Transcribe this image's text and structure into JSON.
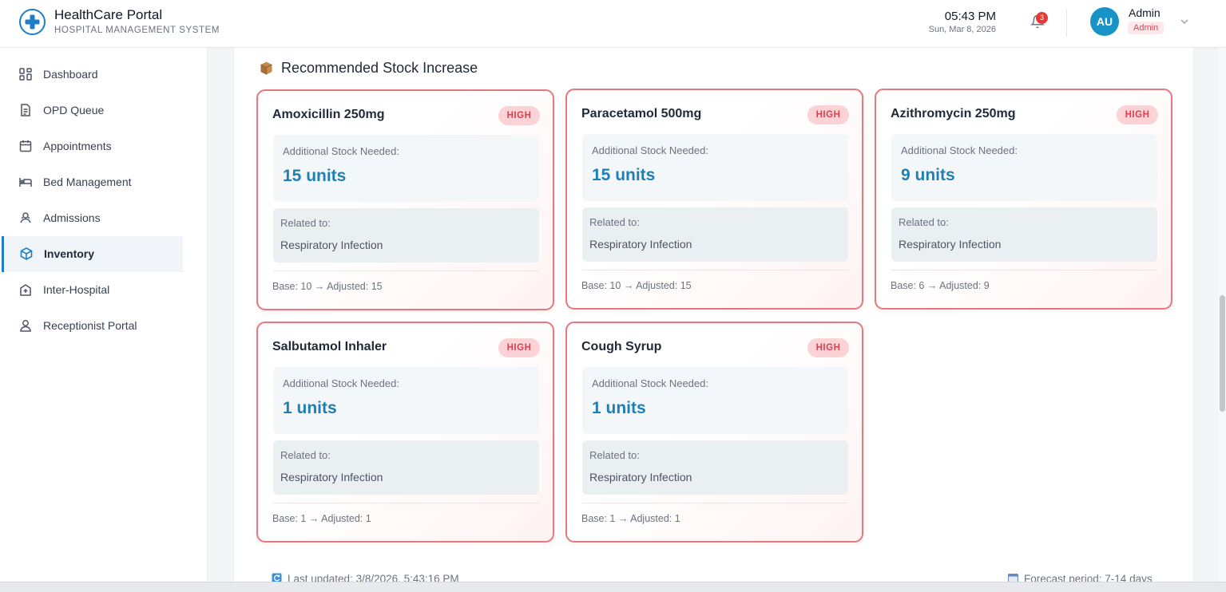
{
  "app": {
    "title": "HealthCare Portal",
    "subtitle": "HOSPITAL MANAGEMENT SYSTEM"
  },
  "header": {
    "time": "05:43 PM",
    "date": "Sun, Mar 8, 2026",
    "notification_count": "3",
    "user_initials": "AU",
    "user_name": "Admin",
    "user_role": "Admin"
  },
  "sidebar": {
    "items": [
      {
        "label": "Dashboard",
        "icon": "grid-icon"
      },
      {
        "label": "OPD Queue",
        "icon": "clipboard-icon"
      },
      {
        "label": "Appointments",
        "icon": "calendar-icon"
      },
      {
        "label": "Bed Management",
        "icon": "bed-icon"
      },
      {
        "label": "Admissions",
        "icon": "person-icon"
      },
      {
        "label": "Inventory",
        "icon": "box-icon",
        "active": true
      },
      {
        "label": "Inter-Hospital",
        "icon": "hospital-icon"
      },
      {
        "label": "Receptionist Portal",
        "icon": "user-icon"
      }
    ]
  },
  "section": {
    "title": "Recommended Stock Increase",
    "icon": "package-icon"
  },
  "cards": [
    {
      "name": "Amoxicillin 250mg",
      "priority": "HIGH",
      "stock_label": "Additional Stock Needed:",
      "stock": "15 units",
      "related_label": "Related to:",
      "related": "Respiratory Infection",
      "base": "Base: 10 → Adjusted: 15"
    },
    {
      "name": "Paracetamol 500mg",
      "priority": "HIGH",
      "stock_label": "Additional Stock Needed:",
      "stock": "15 units",
      "related_label": "Related to:",
      "related": "Respiratory Infection",
      "base": "Base: 10 → Adjusted: 15"
    },
    {
      "name": "Azithromycin 250mg",
      "priority": "HIGH",
      "stock_label": "Additional Stock Needed:",
      "stock": "9 units",
      "related_label": "Related to:",
      "related": "Respiratory Infection",
      "base": "Base: 6 → Adjusted: 9"
    },
    {
      "name": "Salbutamol Inhaler",
      "priority": "HIGH",
      "stock_label": "Additional Stock Needed:",
      "stock": "1 units",
      "related_label": "Related to:",
      "related": "Respiratory Infection",
      "base": "Base: 1 → Adjusted: 1"
    },
    {
      "name": "Cough Syrup",
      "priority": "HIGH",
      "stock_label": "Additional Stock Needed:",
      "stock": "1 units",
      "related_label": "Related to:",
      "related": "Respiratory Infection",
      "base": "Base: 1 → Adjusted: 1"
    }
  ],
  "footer": {
    "last_updated": "Last updated: 3/8/2026, 5:43:16 PM",
    "forecast_period": "Forecast period: 7-14 days"
  },
  "colors": {
    "accent": "#1e7ec8",
    "card_border": "#e8787f",
    "badge_bg": "#fbd3d6",
    "badge_text": "#d7424f",
    "stock_value": "#1f7fb3"
  }
}
